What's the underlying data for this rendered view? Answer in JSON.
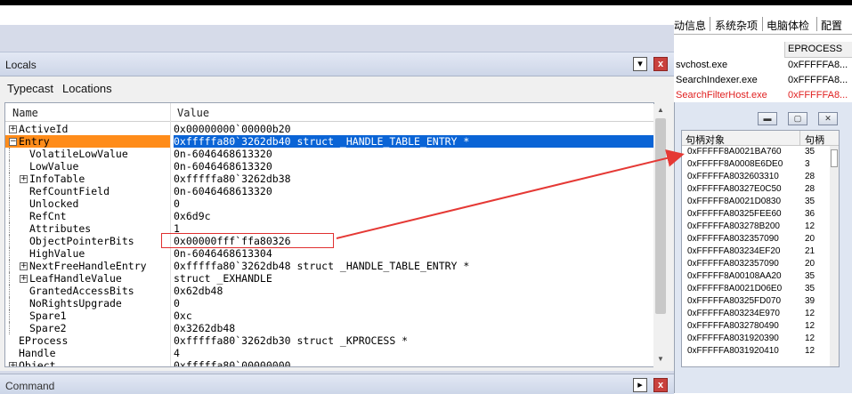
{
  "locals_panel": {
    "title": "Locals",
    "pin_icon": "pin-icon",
    "close_label": "x",
    "toolbar": {
      "typecast": "Typecast",
      "locations": "Locations"
    },
    "columns": {
      "name": "Name",
      "value": "Value"
    },
    "rows": [
      {
        "name": "ActiveId",
        "value": "0x00000000`00000b20",
        "expander": "+",
        "level": 0,
        "selected": false
      },
      {
        "name": "Entry",
        "value": "0xfffffa80`3262db40 struct _HANDLE_TABLE_ENTRY *",
        "expander": "−",
        "level": 0,
        "selected": true
      },
      {
        "name": "VolatileLowValue",
        "value": "0n-6046468613320",
        "expander": "",
        "level": 1,
        "selected": false
      },
      {
        "name": "LowValue",
        "value": "0n-6046468613320",
        "expander": "",
        "level": 1,
        "selected": false
      },
      {
        "name": "InfoTable",
        "value": "0xfffffa80`3262db38",
        "expander": "+",
        "level": 1,
        "selected": false
      },
      {
        "name": "RefCountField",
        "value": "0n-6046468613320",
        "expander": "",
        "level": 1,
        "selected": false
      },
      {
        "name": "Unlocked",
        "value": "0",
        "expander": "",
        "level": 1,
        "selected": false
      },
      {
        "name": "RefCnt",
        "value": "0x6d9c",
        "expander": "",
        "level": 1,
        "selected": false
      },
      {
        "name": "Attributes",
        "value": "1",
        "expander": "",
        "level": 1,
        "selected": false
      },
      {
        "name": "ObjectPointerBits",
        "value": "0x00000fff`ffa80326",
        "expander": "",
        "level": 1,
        "selected": false
      },
      {
        "name": "HighValue",
        "value": "0n-6046468613304",
        "expander": "",
        "level": 1,
        "selected": false
      },
      {
        "name": "NextFreeHandleEntry",
        "value": "0xfffffa80`3262db48 struct _HANDLE_TABLE_ENTRY *",
        "expander": "+",
        "level": 1,
        "selected": false
      },
      {
        "name": "LeafHandleValue",
        "value": "struct _EXHANDLE",
        "expander": "+",
        "level": 1,
        "selected": false
      },
      {
        "name": "GrantedAccessBits",
        "value": "0x62db48",
        "expander": "",
        "level": 1,
        "selected": false
      },
      {
        "name": "NoRightsUpgrade",
        "value": "0",
        "expander": "",
        "level": 1,
        "selected": false
      },
      {
        "name": "Spare1",
        "value": "0xc",
        "expander": "",
        "level": 1,
        "selected": false
      },
      {
        "name": "Spare2",
        "value": "0x3262db48",
        "expander": "",
        "level": 1,
        "selected": false
      },
      {
        "name": "EProcess",
        "value": "0xfffffa80`3262db30 struct _KPROCESS *",
        "expander": "",
        "level": 0,
        "selected": false
      },
      {
        "name": "Handle",
        "value": "4",
        "expander": "",
        "level": 0,
        "selected": false
      },
      {
        "name": "Object",
        "value": "0xfffffa80`00000000",
        "expander": "+",
        "level": 0,
        "selected": false
      }
    ]
  },
  "command_panel": {
    "title": "Command"
  },
  "right_app": {
    "menu": [
      "动信息",
      "系统杂项",
      "电脑体检",
      "配置"
    ],
    "eprocess_header": "EPROCESS",
    "processes": [
      {
        "name": "svchost.exe",
        "eprocess": "0xFFFFFA8...",
        "red": false
      },
      {
        "name": "SearchIndexer.exe",
        "eprocess": "0xFFFFFA8...",
        "red": false
      },
      {
        "name": "SearchFilterHost.exe",
        "eprocess": "0xFFFFFA8...",
        "red": true
      }
    ],
    "handle_window": {
      "columns": {
        "object": "句柄对象",
        "count": "句柄"
      },
      "rows": [
        {
          "object": "0xFFFFF8A0021BA760",
          "count": "35"
        },
        {
          "object": "0xFFFFF8A0008E6DE0",
          "count": "3"
        },
        {
          "object": "0xFFFFFA8032603310",
          "count": "28"
        },
        {
          "object": "0xFFFFFA80327E0C50",
          "count": "28"
        },
        {
          "object": "0xFFFFF8A0021D0830",
          "count": "35"
        },
        {
          "object": "0xFFFFFA80325FEE60",
          "count": "36"
        },
        {
          "object": "0xFFFFFA803278B200",
          "count": "12"
        },
        {
          "object": "0xFFFFFA8032357090",
          "count": "20"
        },
        {
          "object": "0xFFFFFA803234EF20",
          "count": "21"
        },
        {
          "object": "0xFFFFFA8032357090",
          "count": "20"
        },
        {
          "object": "0xFFFFF8A00108AA20",
          "count": "35"
        },
        {
          "object": "0xFFFFF8A0021D06E0",
          "count": "35"
        },
        {
          "object": "0xFFFFFA80325FD070",
          "count": "39"
        },
        {
          "object": "0xFFFFFA803234E970",
          "count": "12"
        },
        {
          "object": "0xFFFFFA8032780490",
          "count": "12"
        },
        {
          "object": "0xFFFFFA8031920390",
          "count": "12"
        },
        {
          "object": "0xFFFFFA8031920410",
          "count": "12"
        }
      ]
    }
  },
  "annotation": {
    "arrow_color": "#e53935",
    "box_color": "#e03030"
  }
}
